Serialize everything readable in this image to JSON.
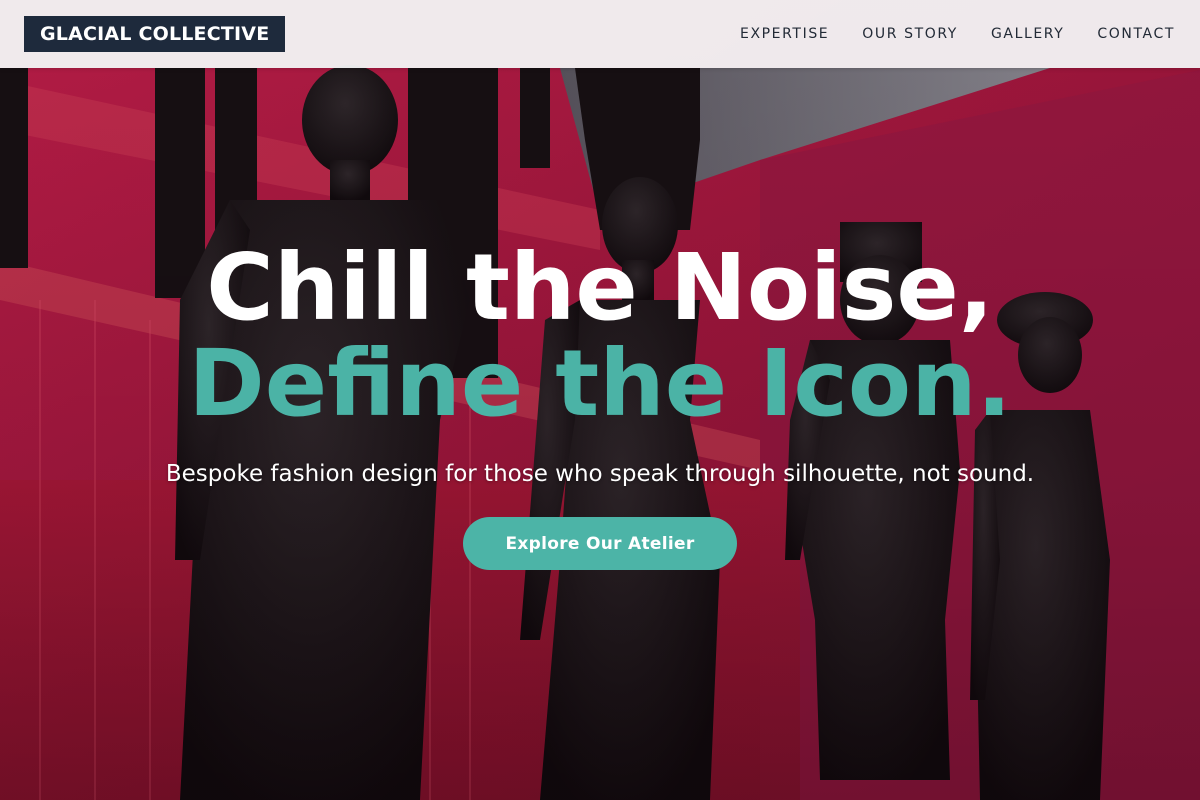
{
  "brand": {
    "name": "GLACIAL COLLECTIVE"
  },
  "nav": {
    "items": [
      {
        "label": "EXPERTISE"
      },
      {
        "label": "OUR STORY"
      },
      {
        "label": "GALLERY"
      },
      {
        "label": "CONTACT"
      }
    ]
  },
  "hero": {
    "headline_line1": "Chill the Noise,",
    "headline_line2": "Define the Icon.",
    "subtitle": "Bespoke fashion design for those who speak through silhouette, not sound.",
    "cta_label": "Explore Our Atelier",
    "background_description_icon": "mannequins-photo"
  },
  "colors": {
    "accent": "#4bb3a6",
    "logo_bg": "#1e2a3c",
    "header_bg": "#f2f2f4",
    "hero_bg": "#a3183e"
  }
}
